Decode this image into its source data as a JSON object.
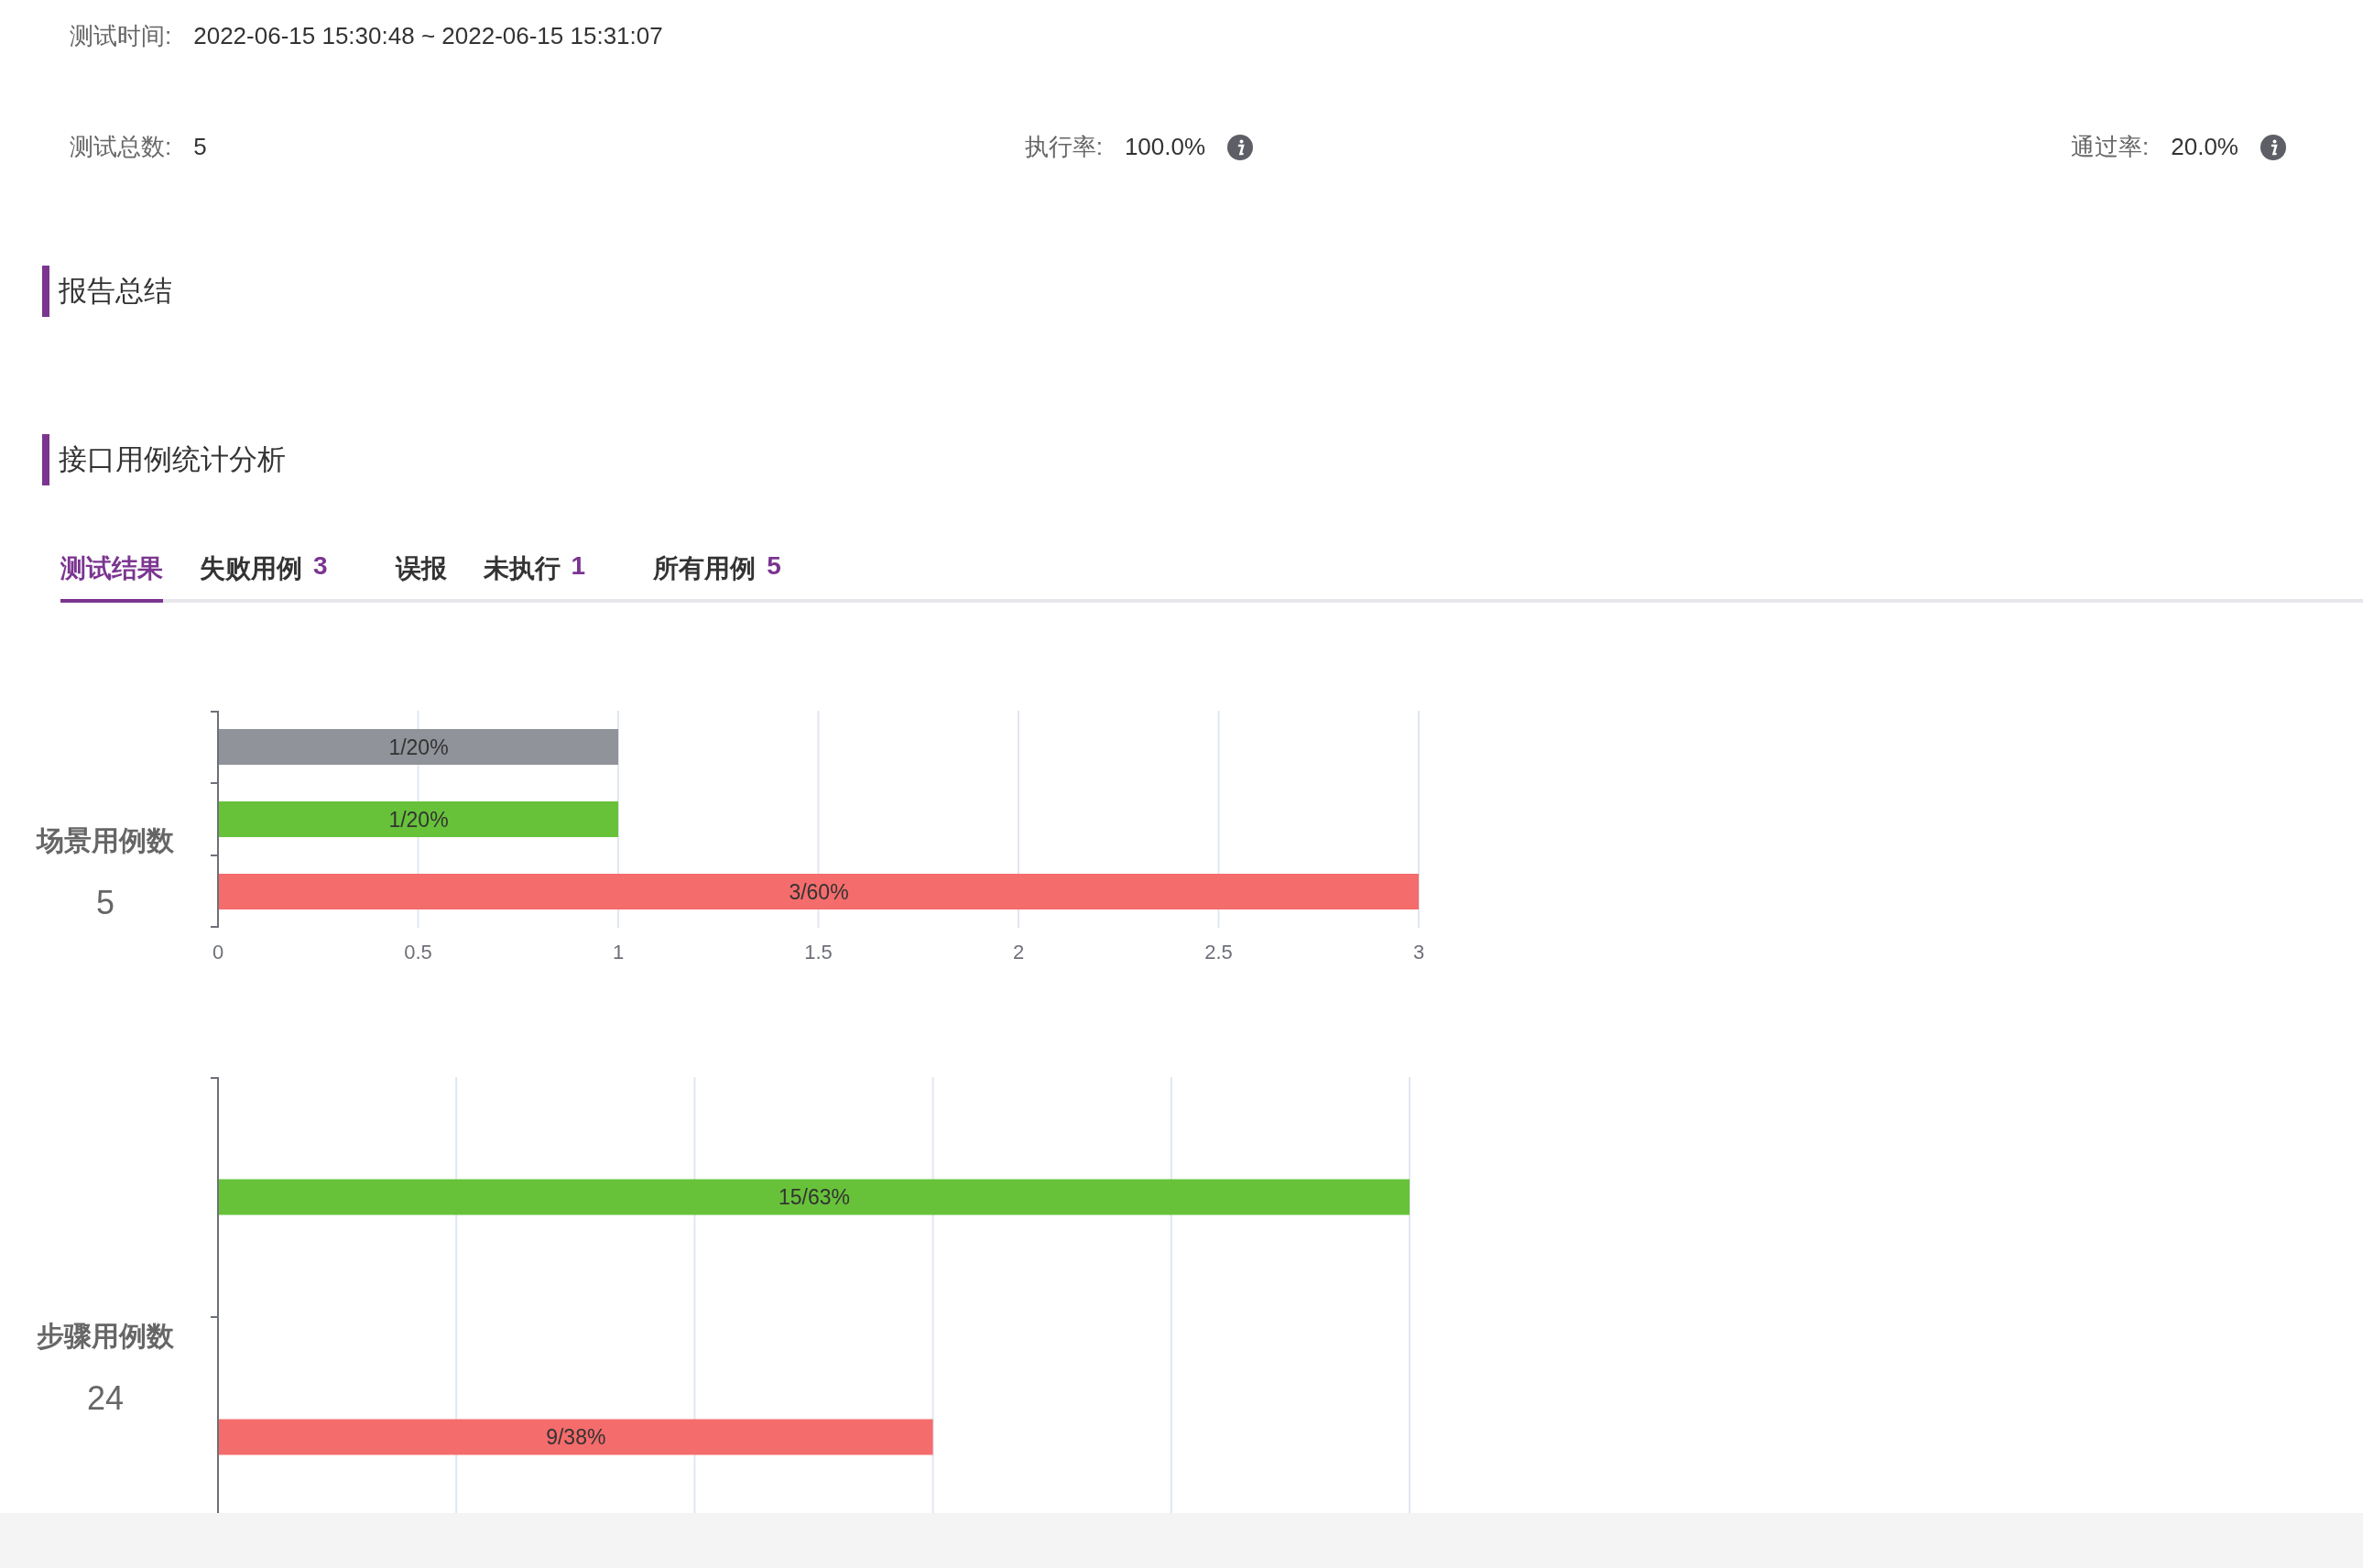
{
  "test_time": {
    "label": "测试时间:",
    "value": "2022-06-15 15:30:48 ~ 2022-06-15 15:31:07"
  },
  "stats": [
    {
      "label": "测试总数:",
      "value": "5",
      "info": false
    },
    {
      "label": "执行率:",
      "value": "100.0%",
      "info": true
    },
    {
      "label": "通过率:",
      "value": "20.0%",
      "info": true
    }
  ],
  "sections": [
    {
      "title": "报告总结"
    },
    {
      "title": "接口用例统计分析"
    }
  ],
  "tabs": [
    {
      "label": "测试结果",
      "selected": true
    },
    {
      "label": "失败用例",
      "count": "3",
      "selected": false
    },
    {
      "label": "误报",
      "selected": false
    },
    {
      "label": "未执行",
      "count": "1",
      "selected": false
    },
    {
      "label": "所有用例",
      "count": "5",
      "selected": false
    }
  ],
  "charts": [
    {
      "title": "场景用例数",
      "total": "5",
      "chart_data": {
        "type": "bar",
        "orientation": "horizontal",
        "values": [
          1,
          1,
          3
        ],
        "colors": [
          "#909399",
          "#67c23a",
          "#f56c6c"
        ],
        "value_labels": [
          "1/20%",
          "1/20%",
          "3/60%"
        ],
        "grid": true,
        "xlim": [
          0,
          3
        ],
        "xticks": [
          0,
          0.5,
          1,
          1.5,
          2,
          2.5,
          3
        ]
      }
    },
    {
      "title": "步骤用例数",
      "total": "24",
      "chart_data": {
        "type": "bar",
        "orientation": "horizontal",
        "values": [
          15,
          9
        ],
        "colors": [
          "#67c23a",
          "#f56c6c"
        ],
        "value_labels": [
          "15/63%",
          "9/38%"
        ],
        "grid": true,
        "xlim": [
          0,
          15
        ]
      }
    }
  ]
}
